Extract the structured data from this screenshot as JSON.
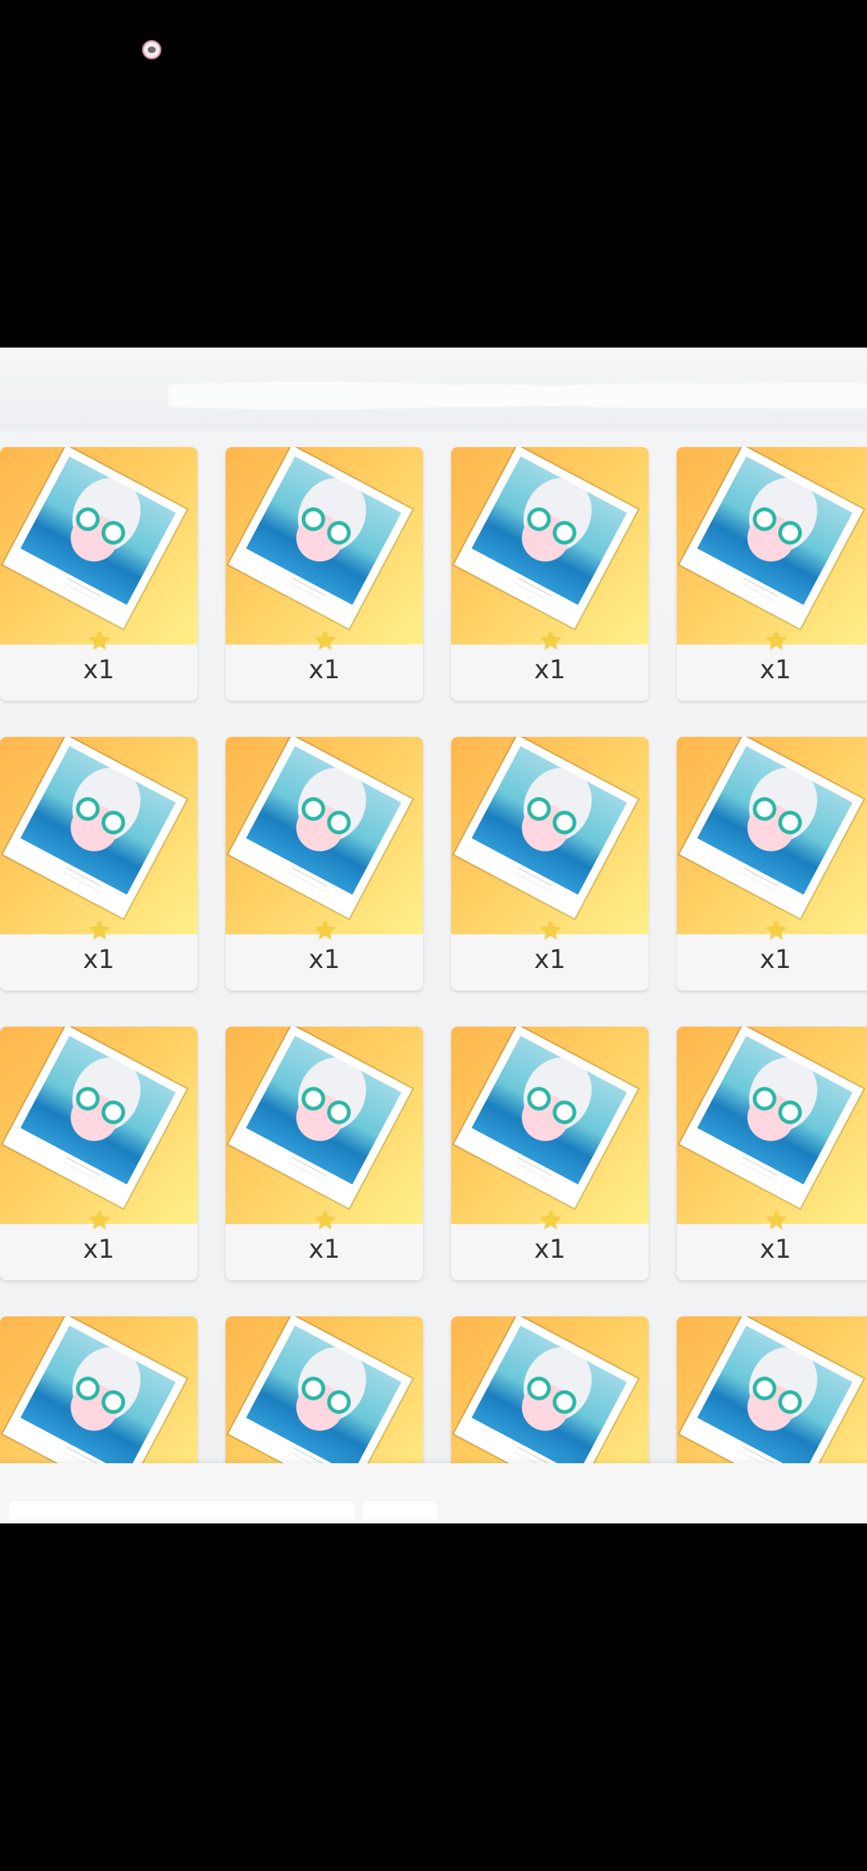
{
  "cards": [
    {
      "quantity": "x1"
    },
    {
      "quantity": "x1"
    },
    {
      "quantity": "x1"
    },
    {
      "quantity": "x1"
    },
    {
      "quantity": "x1"
    },
    {
      "quantity": "x1"
    },
    {
      "quantity": "x1"
    },
    {
      "quantity": "x1"
    },
    {
      "quantity": "x1"
    },
    {
      "quantity": "x1"
    },
    {
      "quantity": "x1"
    },
    {
      "quantity": "x1"
    },
    {
      "quantity": ""
    },
    {
      "quantity": ""
    },
    {
      "quantity": ""
    },
    {
      "quantity": ""
    }
  ]
}
